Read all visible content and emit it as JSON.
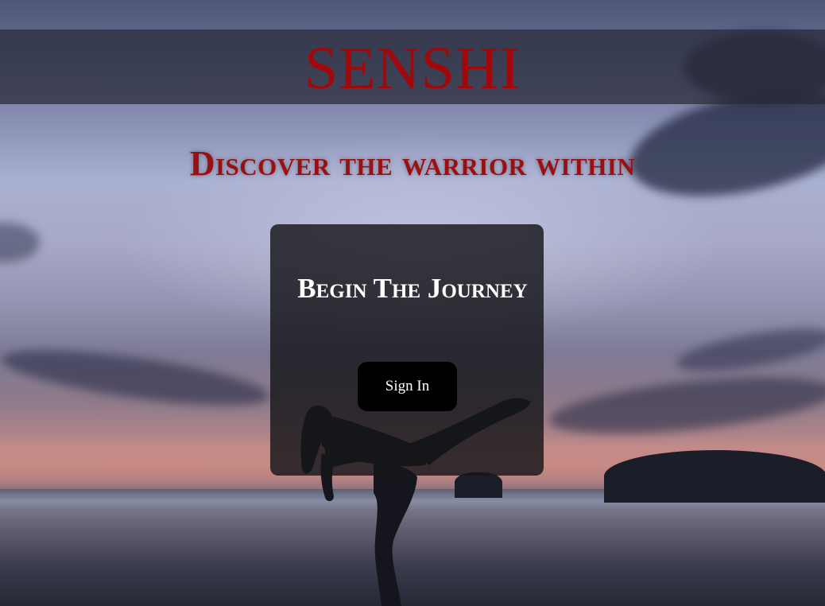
{
  "header": {
    "title": "SENSHI"
  },
  "hero": {
    "tagline": "Discover the warrior within"
  },
  "card": {
    "heading": "Begin The Journey",
    "signin_label": "Sign In"
  },
  "colors": {
    "title_red": "#a1080c",
    "tagline_red": "#9c0f10",
    "button_bg": "#000000",
    "button_text": "#ffffff"
  }
}
